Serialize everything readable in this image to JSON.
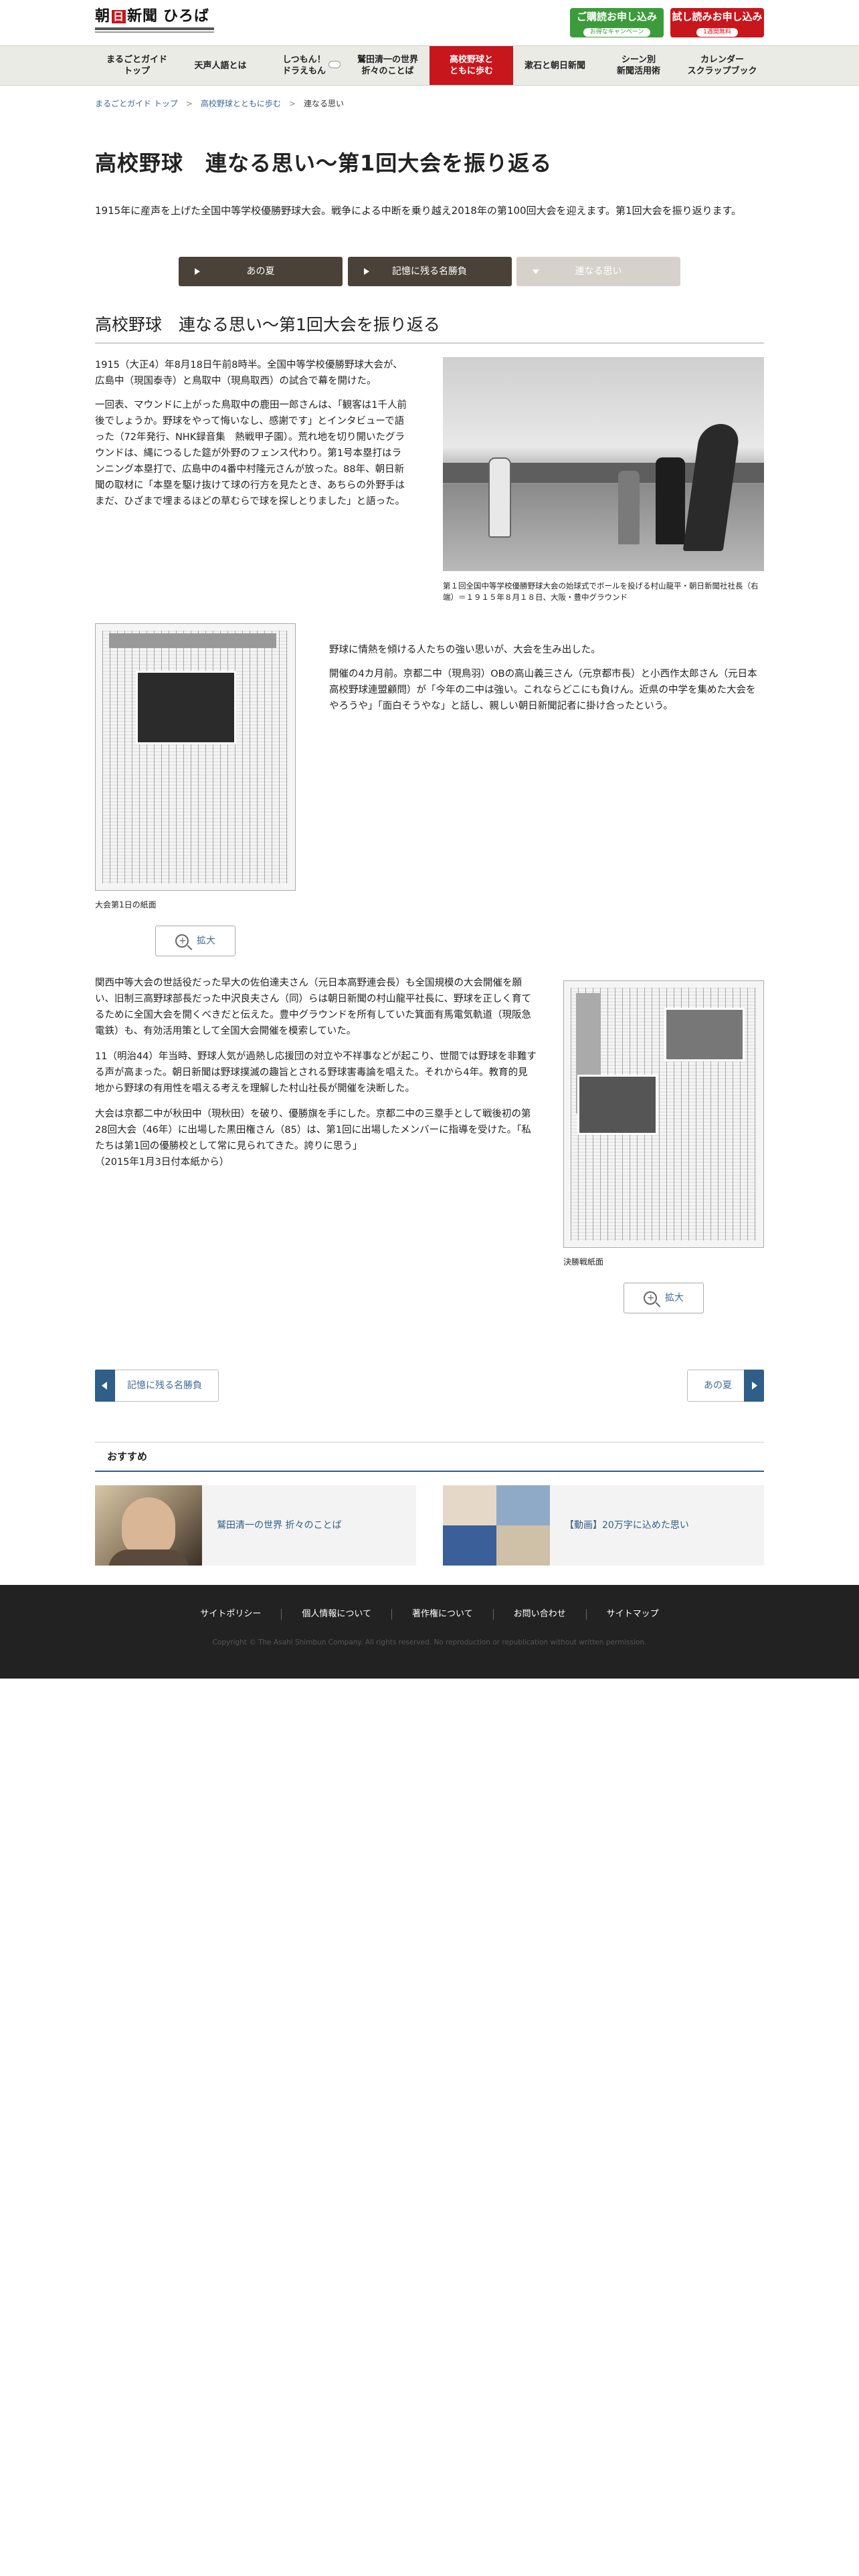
{
  "header": {
    "logo": {
      "name": "朝日新聞",
      "hiroba": "ひろば"
    },
    "cta_subscribe": {
      "title": "ご購読お申し込み",
      "sub": "お得なキャンペーン"
    },
    "cta_trial": {
      "title": "試し読みお申し込み",
      "sub": "1週間無料"
    }
  },
  "nav": {
    "items": [
      {
        "label": "まるごとガイド\nトップ"
      },
      {
        "label": "天声人語とは"
      },
      {
        "label": "しつもん！\nドラえもん"
      },
      {
        "label": "鷲田清一の世界\n折々のことば"
      },
      {
        "label": "高校野球と\nともに歩む"
      },
      {
        "label": "漱石と朝日新聞"
      },
      {
        "label": "シーン別\n新聞活用術"
      },
      {
        "label": "カレンダー\nスクラップブック"
      }
    ]
  },
  "breadcrumb": {
    "items": [
      "まるごとガイド トップ",
      "高校野球とともに歩む",
      "連なる思い"
    ]
  },
  "page": {
    "title": "高校野球　連なる思い〜第1回大会を振り返る",
    "lead": "1915年に産声を上げた全国中等学校優勝野球大会。戦争による中断を乗り越え2018年の第100回大会を迎えます。第1回大会を振り返ります。"
  },
  "tabs": [
    {
      "label": "あの夏"
    },
    {
      "label": "記憶に残る名勝負"
    },
    {
      "label": "連なる思い"
    }
  ],
  "article": {
    "title": "高校野球　連なる思い〜第1回大会を振り返る",
    "p1": "1915（大正4）年8月18日午前8時半。全国中等学校優勝野球大会が、広島中（現国泰寺）と鳥取中（現鳥取西）の試合で幕を開けた。",
    "p2": "一回表、マウンドに上がった鳥取中の鹿田一郎さんは、「観客は1千人前後でしょうか。野球をやって悔いなし、感謝です」とインタビューで語った（72年発行、NHK録音集　熱戦甲子園）。荒れ地を切り開いたグラウンドは、縄につるした筵が外野のフェンス代わり。第1号本塁打はランニング本塁打で、広島中の4番中村隆元さんが放った。88年、朝日新聞の取材に「本塁を駆け抜けて球の行方を見たとき、あちらの外野手はまだ、ひざまで埋まるほどの草むらで球を探しとりました」と語った。",
    "photo_caption": "第１回全国中等学校優勝野球大会の始球式でボールを投げる村山龍平・朝日新聞社社長（右端）＝１９１５年８月１８日、大阪・豊中グラウンド",
    "paper1_caption": "大会第1日の紙面",
    "zoom_label": "拡大",
    "p3": "野球に情熱を傾ける人たちの強い思いが、大会を生み出した。",
    "p4": "開催の4カ月前。京都二中（現鳥羽）OBの高山義三さん（元京都市長）と小西作太郎さん（元日本高校野球連盟顧問）が「今年の二中は強い。これならどこにも負けん。近県の中学を集めた大会をやろうや」「面白そうやな」と話し、親しい朝日新聞記者に掛け合ったという。",
    "p5": "関西中等大会の世話役だった早大の佐伯達夫さん（元日本高野連会長）も全国規模の大会開催を願い、旧制三高野球部長だった中沢良夫さん（同）らは朝日新聞の村山龍平社長に、野球を正しく育てるために全国大会を開くべきだと伝えた。豊中グラウンドを所有していた箕面有馬電気軌道（現阪急電鉄）も、有効活用策として全国大会開催を模索していた。",
    "p6": "11（明治44）年当時、野球人気が過熱し応援団の対立や不祥事などが起こり、世間では野球を非難する声が高まった。朝日新聞は野球撲滅の趣旨とされる野球害毒論を唱えた。それから4年。教育的見地から野球の有用性を唱える考えを理解した村山社長が開催を決断した。",
    "p7": "大会は京都二中が秋田中（現秋田）を破り、優勝旗を手にした。京都二中の三塁手として戦後初の第28回大会（46年）に出場した黒田権さん（85）は、第1回に出場したメンバーに指導を受けた。「私たちは第1回の優勝校として常に見られてきた。誇りに思う」",
    "p7_source": "（2015年1月3日付本紙から）",
    "paper2_caption": "決勝戦紙面"
  },
  "pager": {
    "prev": "記憶に残る名勝負",
    "next": "あの夏"
  },
  "reco": {
    "heading": "おすすめ",
    "cards": [
      {
        "title": "鷲田清一の世界 折々のことば"
      },
      {
        "title": "【動画】20万字に込めた思い"
      }
    ]
  },
  "footer": {
    "links": [
      "サイトポリシー",
      "個人情報について",
      "著作権について",
      "お問い合わせ",
      "サイトマップ"
    ],
    "copyright": "Copyright © The Asahi Shimbun Company. All rights reserved. No reproduction or republication without written permission."
  },
  "colors": {
    "brand_red": "#c8161d",
    "green": "#3c9c3b",
    "tab_dark": "#4a4238",
    "tab_current": "#d6d2cb",
    "link_blue": "#3b6a99",
    "footer_bg": "#222222"
  }
}
